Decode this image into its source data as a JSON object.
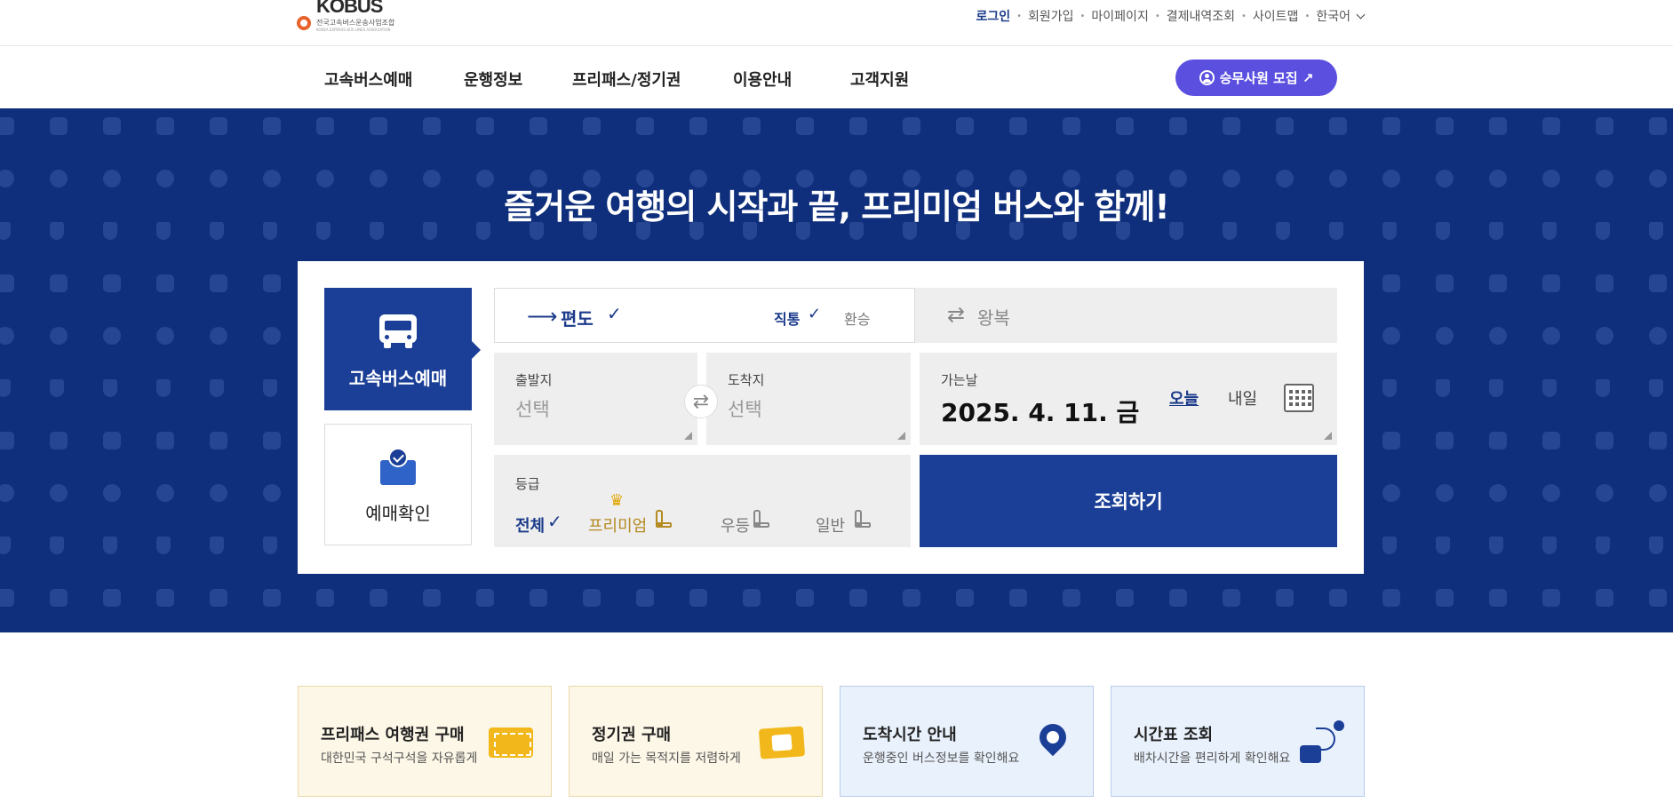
{
  "header": {
    "logo": {
      "word": "KOBUS",
      "sub": "전국고속버스운송사업조합",
      "sub_en": "KOREA EXPRESS BUS LINES ASSOCIATION"
    },
    "util": {
      "login": "로그인",
      "signup": "회원가입",
      "mypage": "마이페이지",
      "payment_history": "결제내역조회",
      "sitemap": "사이트맵",
      "language": "한국어"
    },
    "nav": [
      {
        "label": "고속버스예매"
      },
      {
        "label": "운행정보"
      },
      {
        "label": "프리패스/정기권"
      },
      {
        "label": "이용안내"
      },
      {
        "label": "고객지원"
      }
    ],
    "recruit_button": "승무사원 모집 ↗"
  },
  "hero": {
    "title": "즐거운 여행의 시작과 끝, 프리미엄 버스와 함께!"
  },
  "booking": {
    "tabs": {
      "reserve": "고속버스예매",
      "check": "예매확인"
    },
    "trip": {
      "oneway_label": "편도",
      "oneway_check": "✓",
      "direct_label": "직통",
      "direct_check": "✓",
      "transfer_label": "환승",
      "round_label": "왕복"
    },
    "departure": {
      "caption": "출발지",
      "value": "선택"
    },
    "arrival": {
      "caption": "도착지",
      "value": "선택"
    },
    "date": {
      "caption": "가는날",
      "value": "2025. 4. 11. 금",
      "today": "오늘",
      "tomorrow": "내일"
    },
    "grade": {
      "caption": "등급",
      "all": "전체",
      "all_check": "✓",
      "premium": "프리미엄",
      "first": "우등",
      "normal": "일반"
    },
    "search_button": "조회하기"
  },
  "cards": [
    {
      "title": "프리패스 여행권 구매",
      "desc": "대한민국 구석구석을 자유롭게"
    },
    {
      "title": "정기권 구매",
      "desc": "매일 가는 목적지를 저렴하게"
    },
    {
      "title": "도착시간 안내",
      "desc": "운행중인 버스정보를 확인해요"
    },
    {
      "title": "시간표 조회",
      "desc": "배차시간을 편리하게 확인해요"
    }
  ],
  "colors": {
    "navy": "#1b3f97",
    "hero_bg": "#0f2f7c",
    "recruit": "#5b4fe0",
    "premium_gold": "#b48a21"
  }
}
